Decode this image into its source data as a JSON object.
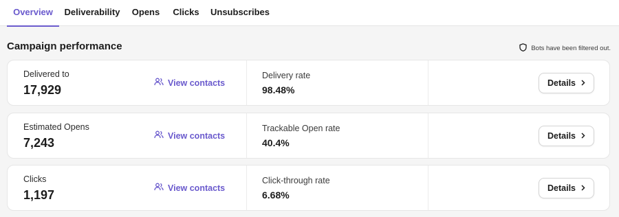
{
  "tabs": [
    {
      "label": "Overview",
      "active": true
    },
    {
      "label": "Deliverability",
      "active": false
    },
    {
      "label": "Opens",
      "active": false
    },
    {
      "label": "Clicks",
      "active": false
    },
    {
      "label": "Unsubscribes",
      "active": false
    }
  ],
  "section": {
    "title": "Campaign performance",
    "bots_note": "Bots have been filtered out."
  },
  "cards": [
    {
      "label": "Delivered to",
      "value": "17,929",
      "link": "View contacts",
      "rate_label": "Delivery rate",
      "rate_value": "98.48%",
      "button": "Details"
    },
    {
      "label": "Estimated Opens",
      "value": "7,243",
      "link": "View contacts",
      "rate_label": "Trackable Open rate",
      "rate_value": "40.4%",
      "button": "Details"
    },
    {
      "label": "Clicks",
      "value": "1,197",
      "link": "View contacts",
      "rate_label": "Click-through rate",
      "rate_value": "6.68%",
      "button": "Details"
    }
  ],
  "colors": {
    "accent": "#6a5acd",
    "background": "#f5f5f5",
    "card": "#ffffff"
  },
  "icons": {
    "bots_note": "shield-icon",
    "link": "users-icon",
    "button": "chevron-right-icon"
  }
}
